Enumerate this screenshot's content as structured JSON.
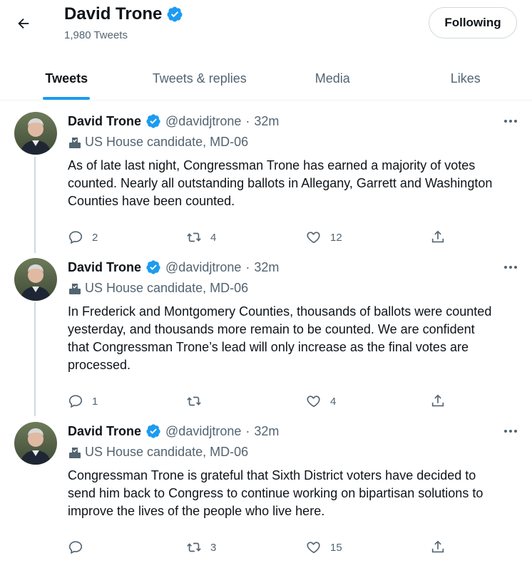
{
  "header": {
    "name": "David Trone",
    "tweet_count": "1,980 Tweets",
    "follow_label": "Following"
  },
  "tabs": [
    {
      "label": "Tweets",
      "active": true
    },
    {
      "label": "Tweets & replies",
      "active": false
    },
    {
      "label": "Media",
      "active": false
    },
    {
      "label": "Likes",
      "active": false
    }
  ],
  "tweets": [
    {
      "name": "David Trone",
      "handle": "@davidjtrone",
      "sep": "·",
      "time": "32m",
      "label": "US House candidate, MD-06",
      "lines": [
        "As of late last night, Congressman Trone has earned a majority of votes",
        "counted. Nearly all outstanding ballots in Allegany, Garrett and Washington",
        "Counties have been counted."
      ],
      "replies": "2",
      "retweets": "4",
      "likes": "12"
    },
    {
      "name": "David Trone",
      "handle": "@davidjtrone",
      "sep": "·",
      "time": "32m",
      "label": "US House candidate, MD-06",
      "lines": [
        "In Frederick and Montgomery Counties, thousands of ballots were counted",
        "yesterday, and thousands more remain to be counted. We are confident",
        "that Congressman Trone’s lead will only increase as the final votes are",
        "processed."
      ],
      "replies": "1",
      "retweets": "",
      "likes": "4"
    },
    {
      "name": "David Trone",
      "handle": "@davidjtrone",
      "sep": "·",
      "time": "32m",
      "label": "US House candidate, MD-06",
      "lines": [
        "Congressman Trone is grateful that Sixth District voters have decided to",
        "send him back to Congress to continue working on bipartisan solutions to",
        "improve the lives of the people who live here."
      ],
      "replies": "",
      "retweets": "3",
      "likes": "15"
    }
  ],
  "colors": {
    "accent": "#1d9bf0",
    "text": "#0f1419",
    "secondary": "#536471"
  }
}
